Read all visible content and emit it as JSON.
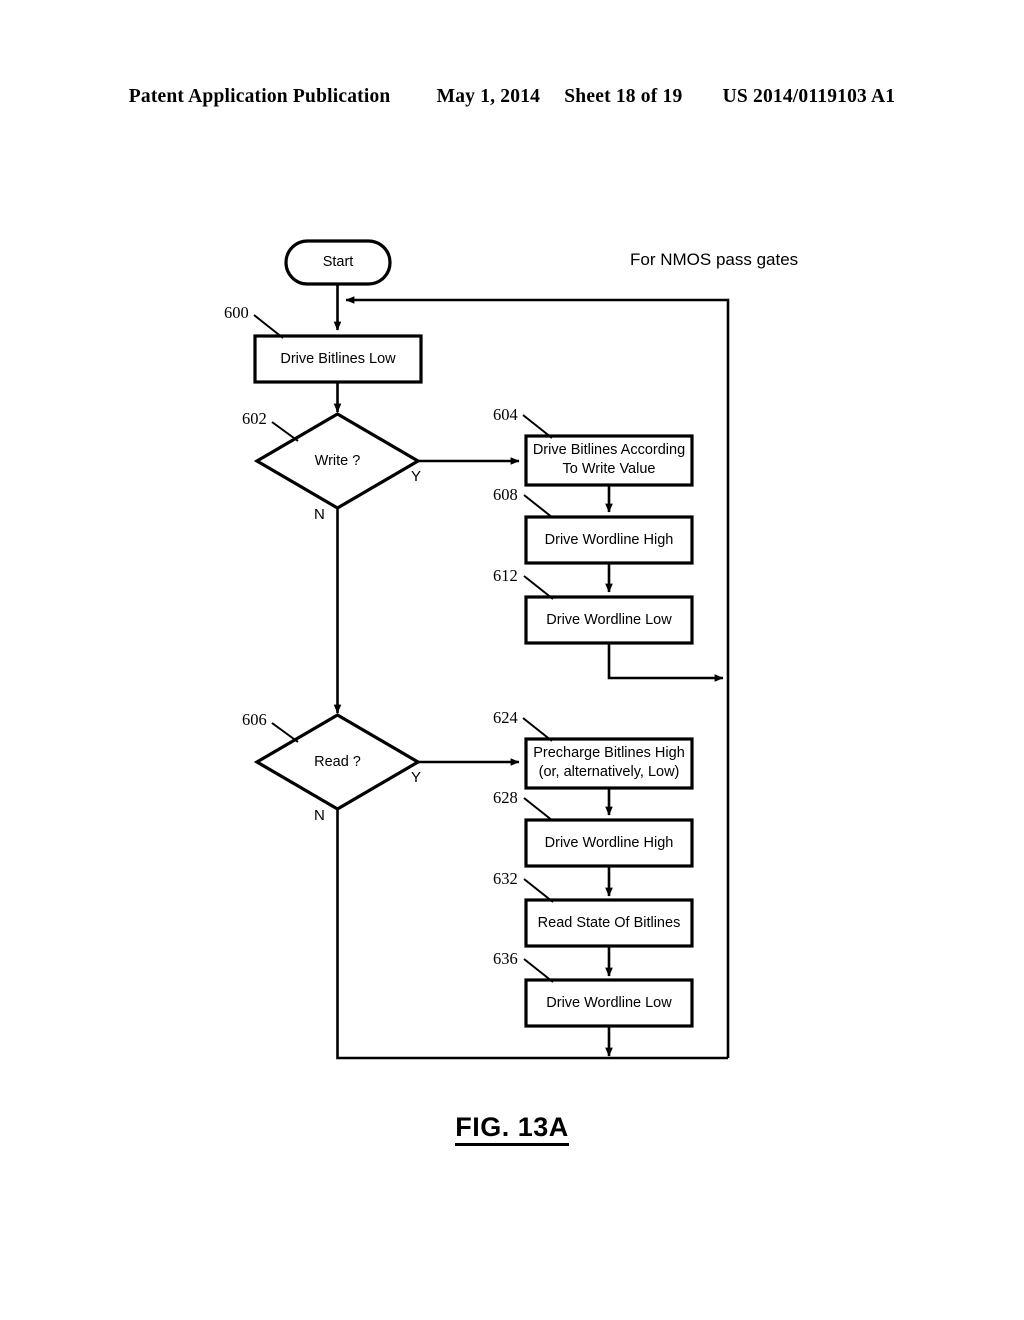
{
  "header": {
    "publication": "Patent Application Publication",
    "date": "May 1, 2014",
    "sheet": "Sheet 18 of 19",
    "number": "US 2014/0119103 A1"
  },
  "figure": {
    "caption": "FIG. 13A",
    "note": "For NMOS pass gates",
    "start_label": "Start",
    "branch_yes": "Y",
    "branch_no": "N",
    "nodes": [
      {
        "ref": "600",
        "label": "Drive Bitlines Low",
        "shape": "process"
      },
      {
        "ref": "602",
        "label": "Write ?",
        "shape": "decision"
      },
      {
        "ref": "604",
        "label": "Drive Bitlines According\nTo Write Value",
        "line1": "Drive Bitlines According",
        "line2": "To Write Value",
        "shape": "process"
      },
      {
        "ref": "608",
        "label": "Drive Wordline High",
        "shape": "process"
      },
      {
        "ref": "612",
        "label": "Drive Wordline Low",
        "shape": "process"
      },
      {
        "ref": "606",
        "label": "Read ?",
        "shape": "decision"
      },
      {
        "ref": "624",
        "label": "Precharge Bitlines High\n(or, alternatively, Low)",
        "line1": "Precharge Bitlines High",
        "line2": "(or, alternatively, Low)",
        "shape": "process"
      },
      {
        "ref": "628",
        "label": "Drive Wordline High",
        "shape": "process"
      },
      {
        "ref": "632",
        "label": "Read State Of Bitlines",
        "shape": "process"
      },
      {
        "ref": "636",
        "label": "Drive Wordline Low",
        "shape": "process"
      }
    ]
  },
  "colors": {
    "ink": "#000000",
    "paper": "#ffffff"
  }
}
